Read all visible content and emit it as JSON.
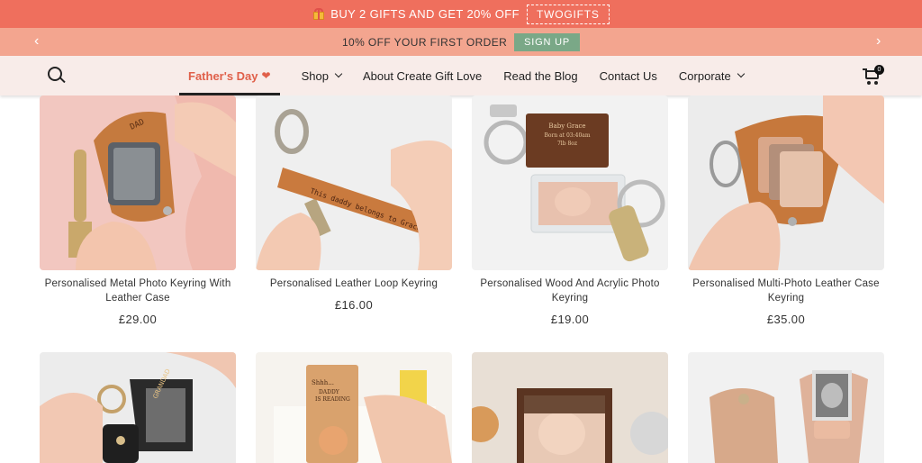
{
  "promo": {
    "text": "BUY 2 GIFTS AND GET 20% OFF",
    "code": "TWOGIFTS",
    "icon": "gift-icon"
  },
  "offer": {
    "text": "10% OFF YOUR FIRST ORDER",
    "button": "SIGN UP",
    "prev_arrow": "‹",
    "next_arrow": "›"
  },
  "nav": {
    "items": [
      {
        "label": "Father's Day",
        "active": true,
        "heart": "❤"
      },
      {
        "label": "Shop",
        "dropdown": true
      },
      {
        "label": "About Create Gift Love"
      },
      {
        "label": "Read the Blog"
      },
      {
        "label": "Contact Us"
      },
      {
        "label": "Corporate",
        "dropdown": true
      }
    ],
    "cart_count": "0"
  },
  "products": [
    {
      "name": "Personalised Metal Photo Keyring With Leather Case",
      "price": "£29.00"
    },
    {
      "name": "Personalised Leather Loop Keyring",
      "price": "£16.00"
    },
    {
      "name": "Personalised Wood And Acrylic Photo Keyring",
      "price": "£19.00"
    },
    {
      "name": "Personalised Multi-Photo Leather Case Keyring",
      "price": "£35.00"
    }
  ],
  "photo_text": {
    "p1_engraving": "DAD",
    "p2_engraving": "This daddy belongs to Grace",
    "p3_engraving_1": "Baby Grace",
    "p3_engraving_2": "Born at 03:40am",
    "p3_engraving_3": "7lb 8oz",
    "p5_engraving": "GRANDAD",
    "p6_engraving_1": "Shhh...",
    "p6_engraving_2": "DADDY",
    "p6_engraving_3": "IS READING"
  },
  "colors": {
    "promo_bg": "#ef6f5d",
    "offer_bg": "#f3a58f",
    "nav_bg": "#f8ece9",
    "accent": "#e0604a",
    "signup_bg": "#7aa887"
  }
}
